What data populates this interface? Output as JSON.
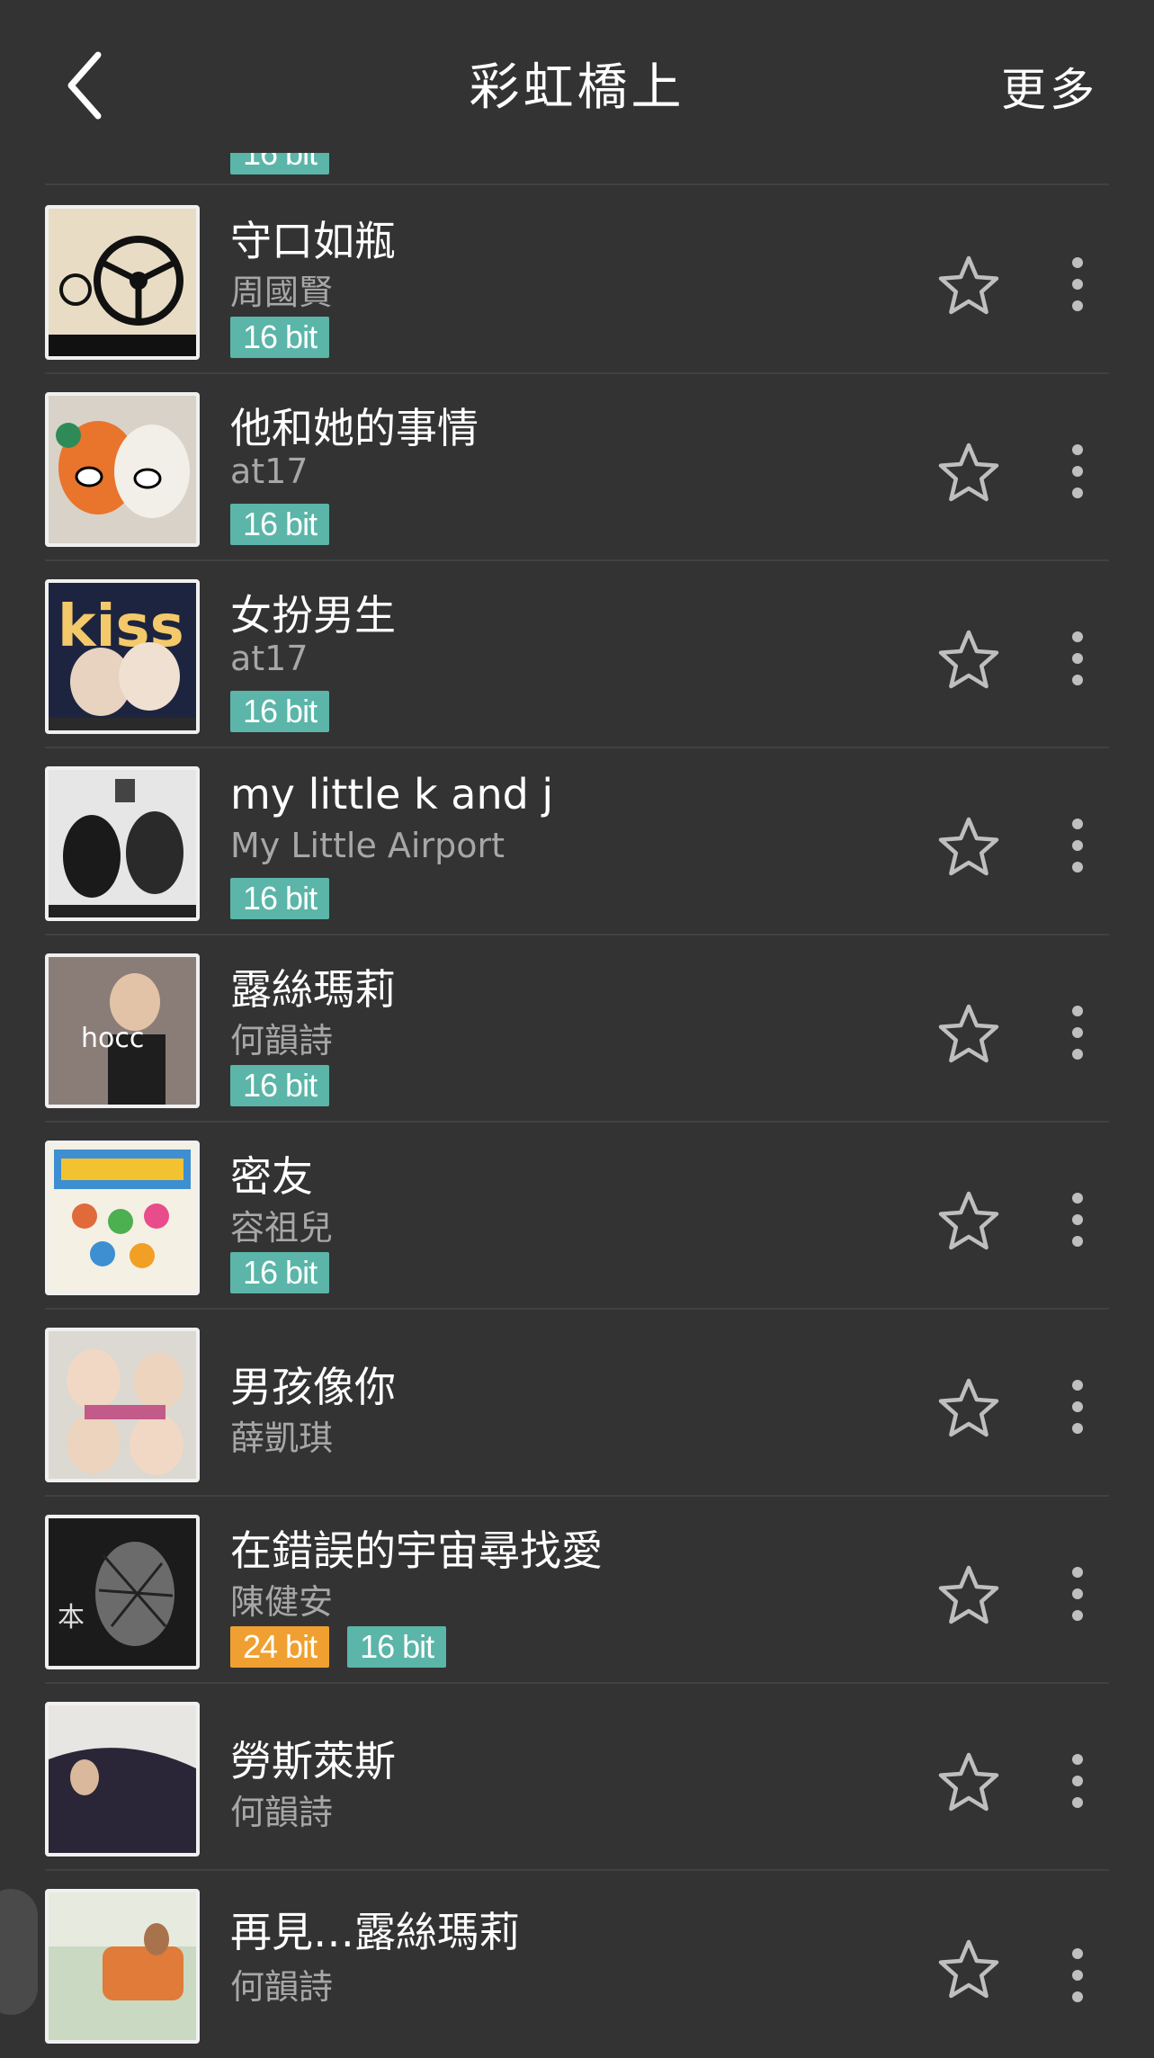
{
  "header": {
    "title": "彩虹橋上",
    "more_label": "更多"
  },
  "partial_top": {
    "badge": "16 bit"
  },
  "tracks": [
    {
      "title": "守口如瓶",
      "artist": "周國賢",
      "badges": [
        "16 bit"
      ]
    },
    {
      "title": "他和她的事情",
      "artist": "at17",
      "badges": [
        "16 bit"
      ]
    },
    {
      "title": "女扮男生",
      "artist": "at17",
      "badges": [
        "16 bit"
      ]
    },
    {
      "title": "my little k and j",
      "artist": "My Little Airport",
      "badges": [
        "16 bit"
      ]
    },
    {
      "title": "露絲瑪莉",
      "artist": "何韻詩",
      "badges": [
        "16 bit"
      ]
    },
    {
      "title": "密友",
      "artist": "容祖兒",
      "badges": [
        "16 bit"
      ]
    },
    {
      "title": "男孩像你",
      "artist": "薛凱琪",
      "badges": []
    },
    {
      "title": "在錯誤的宇宙尋找愛",
      "artist": "陳健安",
      "badges": [
        "24 bit",
        "16 bit"
      ]
    },
    {
      "title": "勞斯萊斯",
      "artist": "何韻詩",
      "badges": []
    },
    {
      "title": "再見…露絲瑪莉",
      "artist": "何韻詩",
      "badges": []
    }
  ],
  "colors": {
    "background": "#333333",
    "badge_16bit": "#5bb5a8",
    "badge_24bit": "#f0a030",
    "artist_text": "#a7a7a7"
  },
  "icons": {
    "back": "chevron-left-icon",
    "favorite": "star-outline-icon",
    "more": "vertical-dots-icon"
  }
}
